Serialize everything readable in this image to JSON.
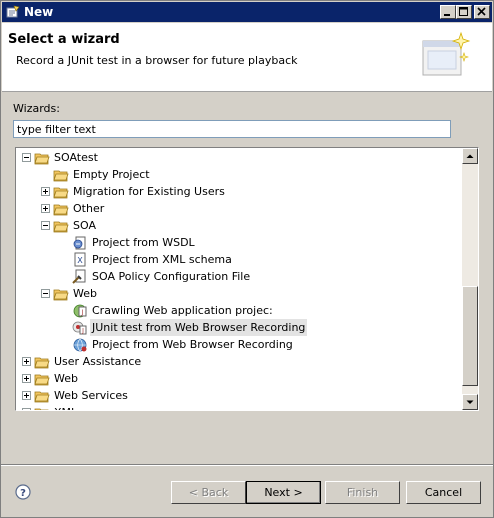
{
  "window": {
    "title": "New",
    "controls": [
      "minimize-icon",
      "maximize-icon",
      "close-icon"
    ]
  },
  "header": {
    "title": "Select a wizard",
    "description": "Record a JUnit test in a browser for future playback",
    "image": "wizard-banner-icon"
  },
  "filter": {
    "label": "Wizards:",
    "value": "type filter text"
  },
  "tree": {
    "items": [
      {
        "label": "SOAtest",
        "level": 0,
        "expander": "minus",
        "icon": "folder-open-icon"
      },
      {
        "label": "Empty Project",
        "level": 1,
        "expander": "none",
        "icon": "folder-open-icon"
      },
      {
        "label": "Migration for Existing Users",
        "level": 1,
        "expander": "plus",
        "icon": "folder-open-icon"
      },
      {
        "label": "Other",
        "level": 1,
        "expander": "plus",
        "icon": "folder-open-icon"
      },
      {
        "label": "SOA",
        "level": 1,
        "expander": "minus",
        "icon": "folder-open-icon"
      },
      {
        "label": "Project from WSDL",
        "level": 2,
        "expander": "none",
        "icon": "wsdl-project-icon"
      },
      {
        "label": "Project from XML schema",
        "level": 2,
        "expander": "none",
        "icon": "xml-schema-icon"
      },
      {
        "label": "SOA Policy Configuration File",
        "level": 2,
        "expander": "none",
        "icon": "policy-file-icon"
      },
      {
        "label": "Web",
        "level": 1,
        "expander": "minus",
        "icon": "folder-open-icon"
      },
      {
        "label": "Crawling Web application projec:",
        "level": 2,
        "expander": "none",
        "icon": "crawl-project-icon"
      },
      {
        "label": "JUnit test from Web Browser Recording",
        "level": 2,
        "expander": "none",
        "icon": "junit-recording-icon",
        "selected": true
      },
      {
        "label": "Project from Web Browser Recording",
        "level": 2,
        "expander": "none",
        "icon": "browser-recording-icon"
      },
      {
        "label": "User Assistance",
        "level": 0,
        "expander": "plus",
        "icon": "folder-open-icon"
      },
      {
        "label": "Web",
        "level": 0,
        "expander": "plus",
        "icon": "folder-open-icon"
      },
      {
        "label": "Web Services",
        "level": 0,
        "expander": "plus",
        "icon": "folder-open-icon"
      },
      {
        "label": "XML",
        "level": 0,
        "expander": "plus",
        "icon": "folder-open-icon"
      }
    ]
  },
  "buttons": {
    "back": "< Back",
    "next": "Next >",
    "finish": "Finish",
    "cancel": "Cancel",
    "help_icon": "help-icon"
  },
  "colors": {
    "titlebar": "#0a246a",
    "dialog": "#d4d0c8",
    "selection": "#e3e3e3",
    "folder": "#f2c660"
  }
}
